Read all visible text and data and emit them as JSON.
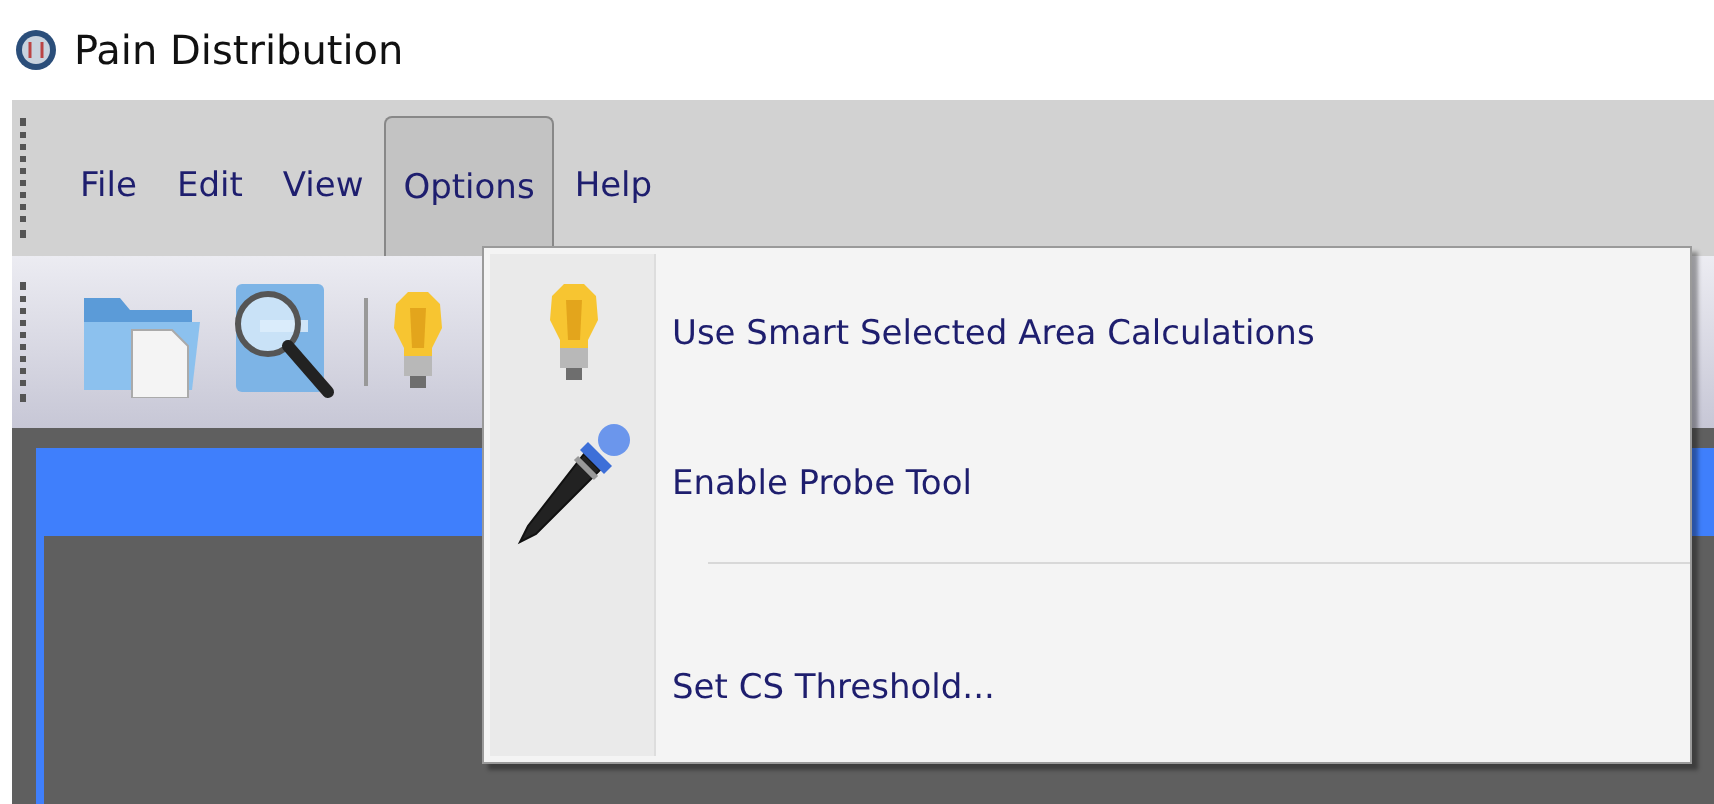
{
  "window": {
    "title": "Pain Distribution"
  },
  "menu_bar": [
    {
      "label": "File",
      "selected": false
    },
    {
      "label": "Edit",
      "selected": false
    },
    {
      "label": "View",
      "selected": false
    },
    {
      "label": "Options",
      "selected": true
    },
    {
      "label": "Help",
      "selected": false
    }
  ],
  "toolbar": [
    {
      "kind": "folder"
    },
    {
      "kind": "search"
    },
    {
      "kind": "separator"
    },
    {
      "kind": "bulb"
    }
  ],
  "dropdown": {
    "items": [
      {
        "kind": "bulb",
        "label": "Use Smart Selected Area Calculations"
      },
      {
        "kind": "dropper",
        "label": "Enable Probe Tool"
      },
      {
        "kind": "separator"
      },
      {
        "kind": "plain",
        "label": "Set CS Threshold..."
      }
    ]
  }
}
